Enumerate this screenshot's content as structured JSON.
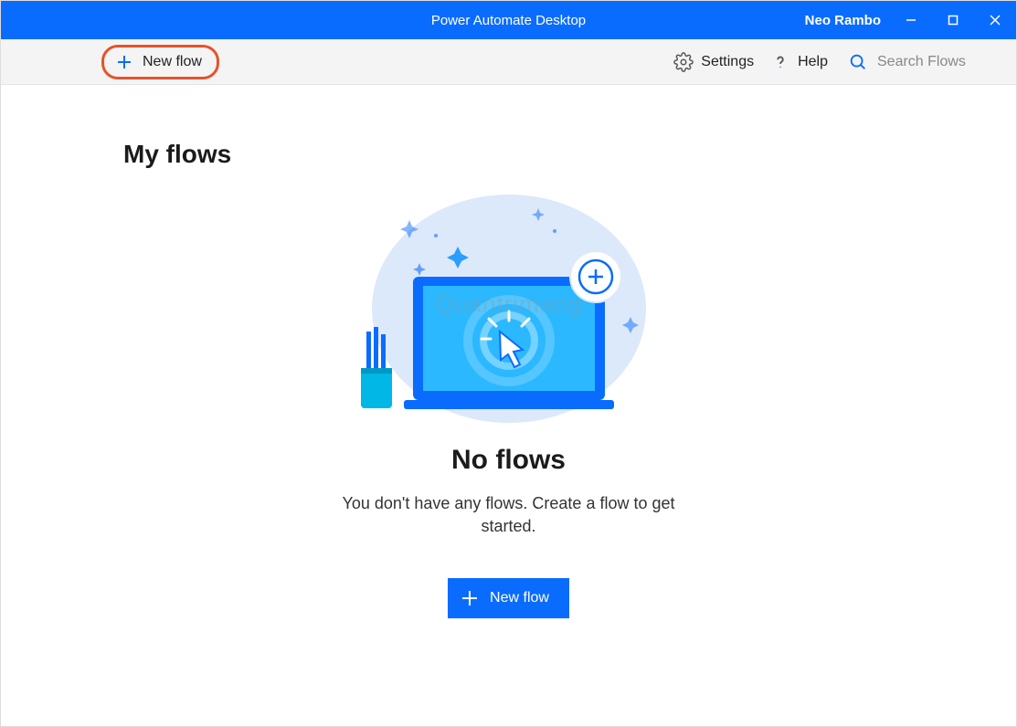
{
  "titlebar": {
    "app_title": "Power Automate Desktop",
    "user_name": "Neo Rambo"
  },
  "toolbar": {
    "new_flow_label": "New flow",
    "settings_label": "Settings",
    "help_label": "Help",
    "search_placeholder": "Search Flows"
  },
  "main": {
    "page_title": "My flows",
    "empty_title": "No flows",
    "empty_subtitle": "You don't have any flows. Create a flow to get started.",
    "new_flow_button": "New flow"
  },
  "watermark": "Quantrimang"
}
